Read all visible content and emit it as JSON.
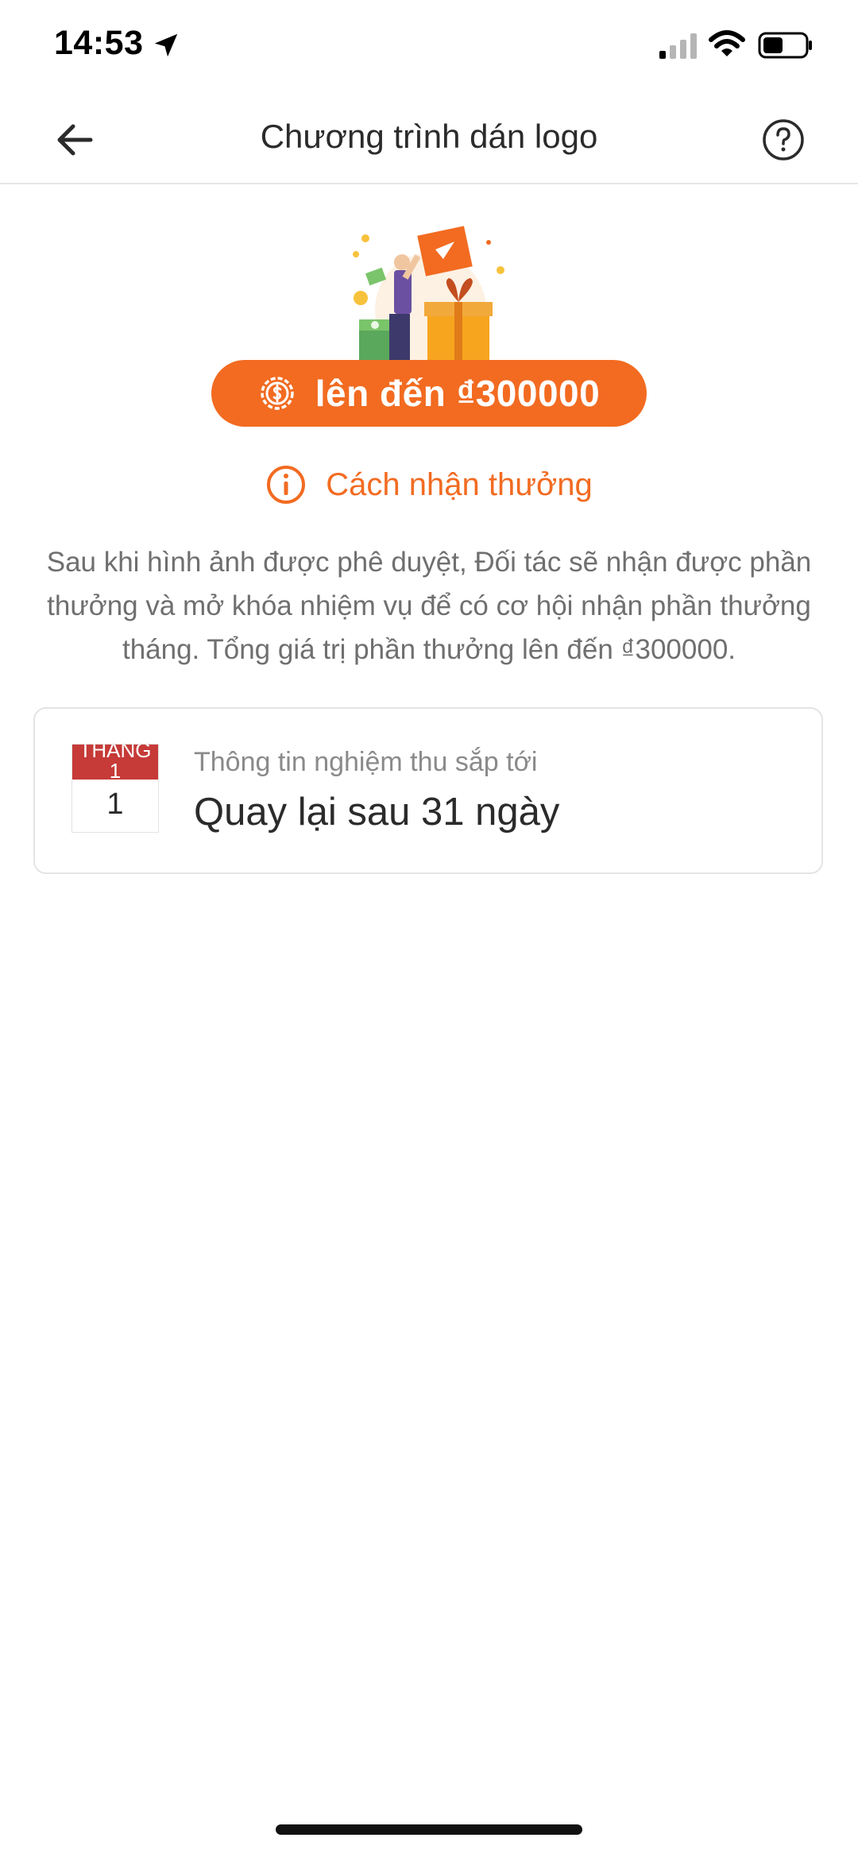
{
  "status_bar": {
    "time": "14:53",
    "icons": [
      "location-arrow-icon",
      "cellular-signal-icon",
      "wifi-icon",
      "battery-icon"
    ]
  },
  "header": {
    "title": "Chương trình dán logo",
    "back_icon": "arrow-left-icon",
    "help_icon": "question-circle-icon"
  },
  "hero": {
    "illustration": "reward-illustration",
    "reward_label": "lên đến ₫300000",
    "reward_icon": "dollar-coin-icon"
  },
  "howto": {
    "label": "Cách nhận thưởng",
    "icon": "info-circle-icon"
  },
  "description": "Sau khi hình ảnh được phê duyệt, Đối tác sẽ nhận được phần thưởng và mở khóa nhiệm vụ để có cơ hội nhận phần thưởng tháng. Tổng giá trị phần thưởng lên đến ₫300000.",
  "card": {
    "calendar": {
      "month": "THÁNG 1",
      "day": "1"
    },
    "subtitle": "Thông tin nghiệm thu sắp tới",
    "title": "Quay lại sau 31 ngày"
  },
  "colors": {
    "accent": "#f26b21",
    "calendar_red": "#c63a38",
    "text_primary": "#2b2b2b",
    "text_secondary": "#6f6f6f"
  }
}
